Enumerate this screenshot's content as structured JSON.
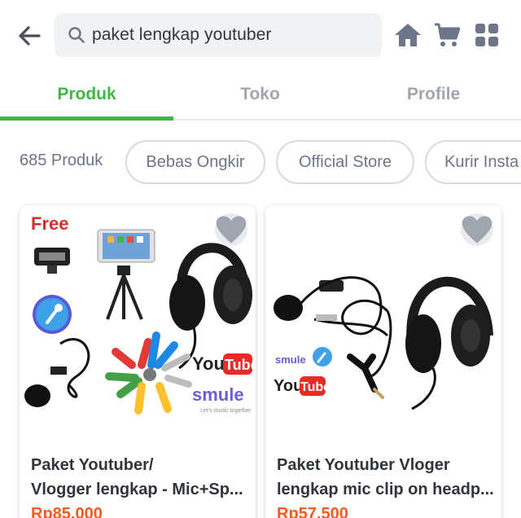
{
  "search": {
    "query": "paket lengkap youtuber"
  },
  "colors": {
    "accent": "#42b549",
    "price": "#fa591d",
    "muted": "#6d7588"
  },
  "icons": {
    "back": "arrow-left-icon",
    "search": "search-icon",
    "home": "home-icon",
    "cart": "cart-icon",
    "menu": "grid-menu-icon",
    "wishlist": "heart-icon"
  },
  "tabs": [
    {
      "label": "Produk",
      "active": true
    },
    {
      "label": "Toko",
      "active": false
    },
    {
      "label": "Profile",
      "active": false
    }
  ],
  "filters": {
    "count": "685 Produk",
    "chips": [
      "Bebas Ongkir",
      "Official Store",
      "Kurir Insta"
    ]
  },
  "products": [
    {
      "title_line1": "Paket Youtuber/",
      "title_line2": "Vlogger lengkap - Mic+Sp...",
      "price": "Rp85.000",
      "image_text": {
        "badge": "Free",
        "brand1_a": "You",
        "brand1_b": "Tube",
        "brand2": "smule",
        "brand2_tag": "Let's music together"
      }
    },
    {
      "title_line1": "Paket Youtuber Vloger",
      "title_line2": "lengkap mic clip on headp...",
      "price": "Rp57.500",
      "image_text": {
        "brand2": "smule",
        "brand1_a": "You",
        "brand1_b": "Tube"
      }
    }
  ]
}
